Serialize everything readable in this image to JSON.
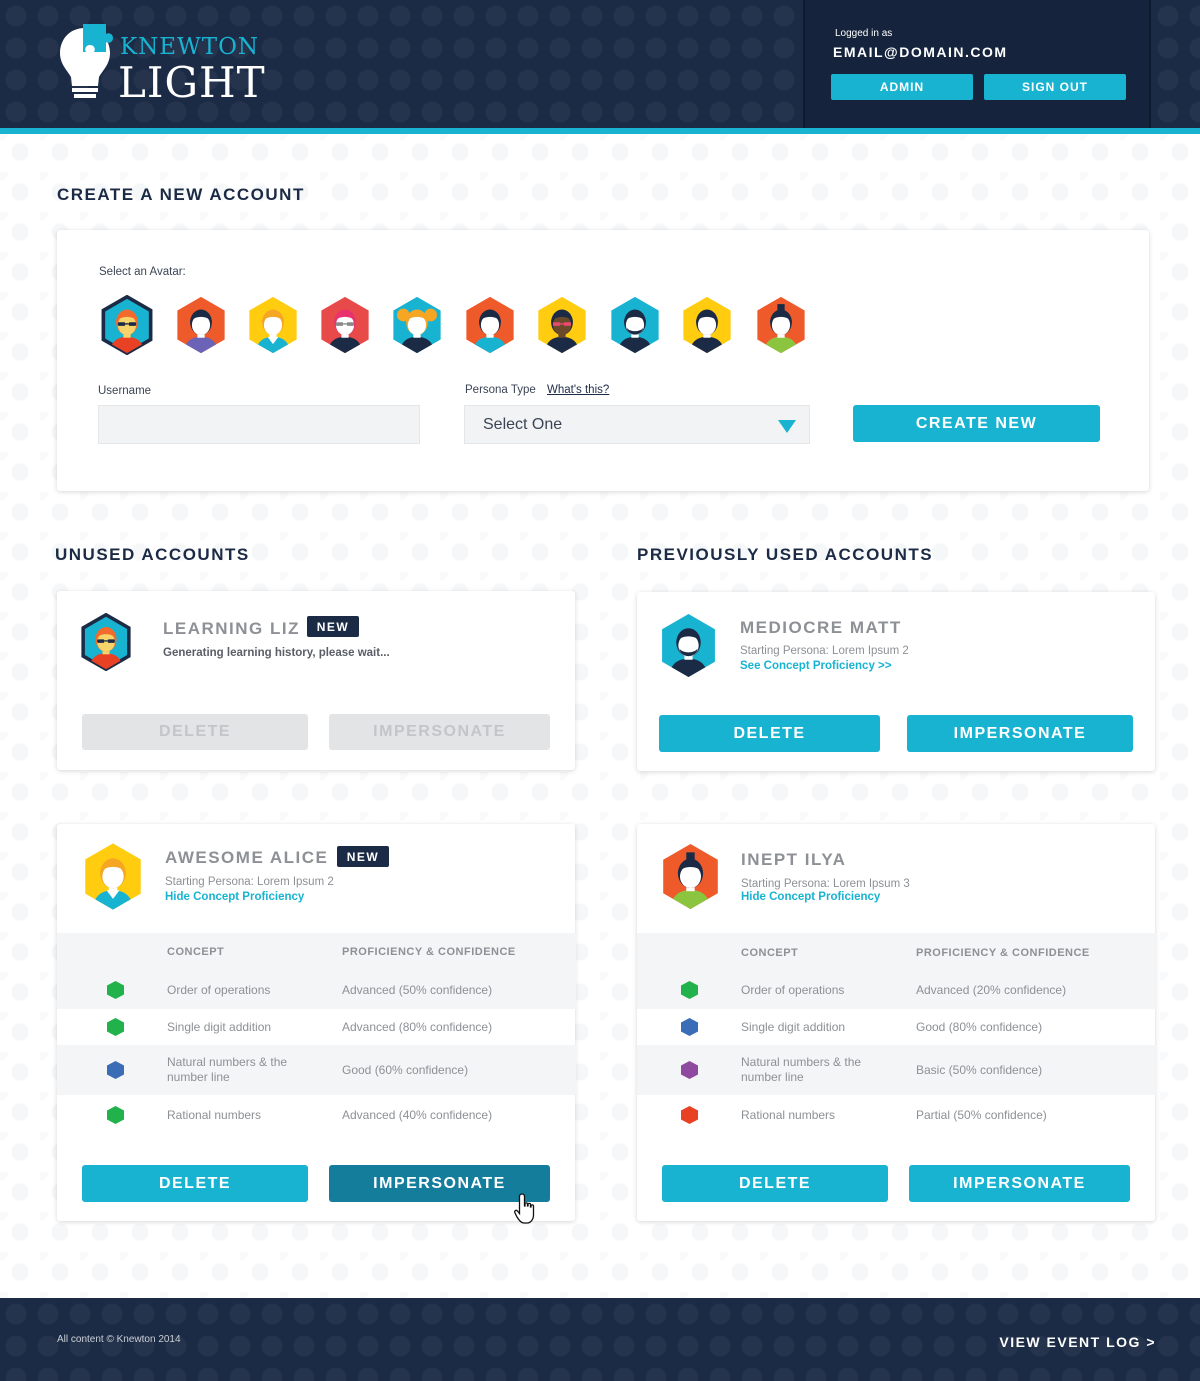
{
  "header": {
    "logo_top": "KNEWTON",
    "logo_bottom": "LIGHT",
    "logged_in_label": "Logged in as",
    "email": "EMAIL@DOMAIN.COM",
    "admin_label": "ADMIN",
    "signout_label": "SIGN OUT"
  },
  "create": {
    "title": "CREATE A NEW ACCOUNT",
    "avatar_label": "Select an Avatar:",
    "username_label": "Username",
    "username_value": "",
    "persona_label": "Persona Type",
    "whats_this": "What's this?",
    "persona_selected": "Select One",
    "create_label": "CREATE NEW"
  },
  "sections": {
    "unused": "UNUSED ACCOUNTS",
    "previous": "PREVIOUSLY USED ACCOUNTS"
  },
  "accounts": {
    "liz": {
      "name": "LEARNING LIZ",
      "badge": "NEW",
      "status": "Generating learning history, please wait...",
      "delete": "DELETE",
      "impersonate": "IMPERSONATE"
    },
    "matt": {
      "name": "MEDIOCRE MATT",
      "persona": "Starting Persona: Lorem Ipsum 2",
      "link": "See Concept Proficiency >>",
      "delete": "DELETE",
      "impersonate": "IMPERSONATE"
    },
    "alice": {
      "name": "AWESOME ALICE",
      "badge": "NEW",
      "persona": "Starting Persona: Lorem Ipsum 2",
      "link": "Hide Concept Proficiency",
      "col_concept": "CONCEPT",
      "col_prof": "PROFICIENCY & CONFIDENCE",
      "rows": [
        {
          "concept": "Order of operations",
          "prof": "Advanced (50% confidence)",
          "color": "#22b24c"
        },
        {
          "concept": "Single digit addition",
          "prof": "Advanced (80% confidence)",
          "color": "#22b24c"
        },
        {
          "concept": "Natural numbers & the",
          "concept2": "number line",
          "prof": "Good (60% confidence)",
          "color": "#3b6cb6"
        },
        {
          "concept": "Rational numbers",
          "prof": "Advanced  (40% confidence)",
          "color": "#22b24c"
        }
      ],
      "delete": "DELETE",
      "impersonate": "IMPERSONATE"
    },
    "ilya": {
      "name": "INEPT ILYA",
      "persona": "Starting Persona: Lorem Ipsum 3",
      "link": "Hide Concept Proficiency",
      "col_concept": "CONCEPT",
      "col_prof": "PROFICIENCY & CONFIDENCE",
      "rows": [
        {
          "concept": "Order of operations",
          "prof": "Advanced (20% confidence)",
          "color": "#22b24c"
        },
        {
          "concept": "Single digit addition",
          "prof": "Good (80% confidence)",
          "color": "#3b6cb6"
        },
        {
          "concept": "Natural numbers & the",
          "concept2": "number line",
          "prof": "Basic (50% confidence)",
          "color": "#8e4a9f"
        },
        {
          "concept": "Rational numbers",
          "prof": "Partial  (50% confidence)",
          "color": "#e84124"
        }
      ],
      "delete": "DELETE",
      "impersonate": "IMPERSONATE"
    }
  },
  "footer": {
    "copyright": "All content © Knewton 2014",
    "event_log": "VIEW EVENT LOG >"
  },
  "colors": {
    "navy": "#1c2b45",
    "accent": "#19b3d2",
    "accent_pressed": "#157d9c"
  }
}
